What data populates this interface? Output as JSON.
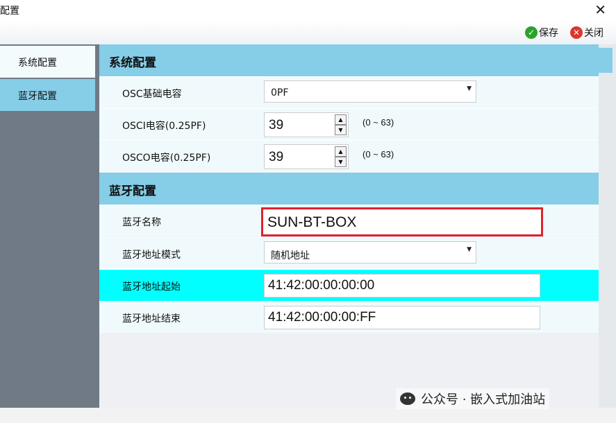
{
  "window": {
    "title": "配置",
    "close_glyph": "✕"
  },
  "toolbar": {
    "save_label": "保存",
    "close_label": "关闭",
    "save_glyph": "✓",
    "close_glyph": "✕"
  },
  "nav": {
    "items": [
      {
        "label": "系统配置",
        "selected": true
      },
      {
        "label": "蓝牙配置",
        "selected": false
      }
    ]
  },
  "system": {
    "header": "系统配置",
    "osc_base": {
      "label": "OSC基础电容",
      "value": "0PF"
    },
    "osci": {
      "label": "OSCI电容(0.25PF)",
      "value": "39",
      "range": "(0 ~ 63)"
    },
    "osco": {
      "label": "OSCO电容(0.25PF)",
      "value": "39",
      "range": "(0 ~ 63)"
    }
  },
  "bluetooth": {
    "header": "蓝牙配置",
    "name": {
      "label": "蓝牙名称",
      "value": "SUN-BT-BOX"
    },
    "addr_mode": {
      "label": "蓝牙地址模式",
      "value": "随机地址"
    },
    "addr_start": {
      "label": "蓝牙地址起始",
      "value": "41:42:00:00:00:00"
    },
    "addr_end": {
      "label": "蓝牙地址结束",
      "value": "41:42:00:00:00:FF"
    }
  },
  "watermark": {
    "text": "公众号 · 嵌入式加油站"
  },
  "colors": {
    "header_bg": "#86cde8",
    "highlight_row": "#00ffff",
    "nav_bg": "#6f7a86",
    "red_border": "#e2202c"
  }
}
